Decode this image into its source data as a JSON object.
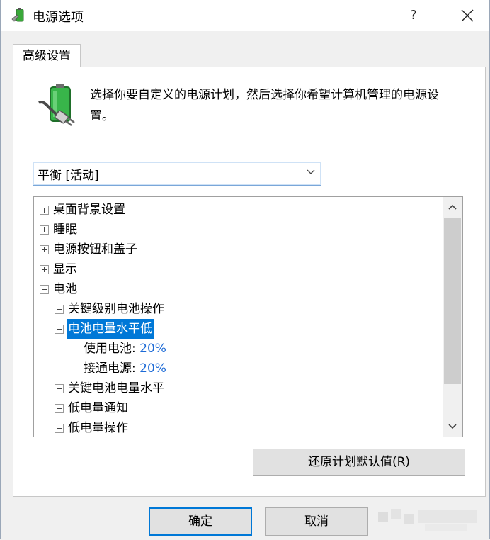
{
  "window": {
    "title": "电源选项",
    "help_label": "?",
    "close_icon": "close-icon"
  },
  "tabs": [
    {
      "label": "高级设置",
      "active": true
    }
  ],
  "description": "选择你要自定义的电源计划，然后选择你希望计算机管理的电源设置。",
  "plan_select": {
    "value": "平衡 [活动]"
  },
  "tree": {
    "items": [
      {
        "label": "桌面背景设置",
        "expander": "plus"
      },
      {
        "label": "睡眠",
        "expander": "plus"
      },
      {
        "label": "电源按钮和盖子",
        "expander": "plus"
      },
      {
        "label": "显示",
        "expander": "plus"
      },
      {
        "label": "电池",
        "expander": "minus"
      },
      {
        "label": "关键级别电池操作",
        "expander": "plus"
      },
      {
        "label": "电池电量水平低",
        "expander": "minus",
        "selected": true
      },
      {
        "label": "使用电池:",
        "value": "20%"
      },
      {
        "label": "接通电源:",
        "value": "20%"
      },
      {
        "label": "关键电池电量水平",
        "expander": "plus"
      },
      {
        "label": "低电量通知",
        "expander": "plus"
      },
      {
        "label": "低电量操作",
        "expander": "plus"
      }
    ]
  },
  "buttons": {
    "restore": "还原计划默认值(R)",
    "ok": "确定",
    "cancel": "取消"
  },
  "colors": {
    "accent": "#0078d7",
    "value_text": "#1c6ad6",
    "dialog_bg": "#f0f0f0"
  }
}
